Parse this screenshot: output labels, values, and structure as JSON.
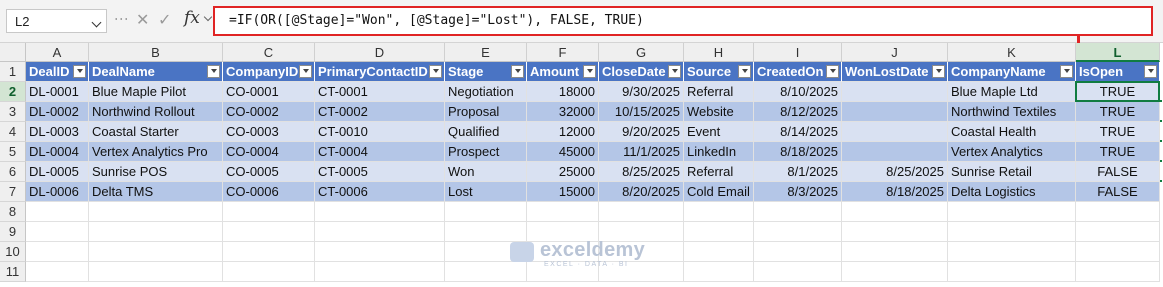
{
  "namebox": {
    "value": "L2"
  },
  "formula": {
    "text": "=IF(OR([@Stage]=\"Won\", [@Stage]=\"Lost\"), FALSE, TRUE)"
  },
  "toolbar_icons": [
    "cancel-icon",
    "enter-check-icon",
    "insert-function-icon"
  ],
  "columns": [
    "A",
    "B",
    "C",
    "D",
    "E",
    "F",
    "G",
    "H",
    "I",
    "J",
    "K",
    "L"
  ],
  "active_column": "L",
  "rows": [
    "1",
    "2",
    "3",
    "4",
    "5",
    "6",
    "7",
    "8",
    "9",
    "10",
    "11"
  ],
  "active_row": "2",
  "table": {
    "headers": [
      "DealID",
      "DealName",
      "CompanyID",
      "PrimaryContactID",
      "Stage",
      "Amount",
      "CloseDate",
      "Source",
      "CreatedOn",
      "WonLostDate",
      "CompanyName",
      "IsOpen"
    ],
    "rows": [
      [
        "DL-0001",
        "Blue Maple Pilot",
        "CO-0001",
        "CT-0001",
        "Negotiation",
        "18000",
        "9/30/2025",
        "Referral",
        "8/10/2025",
        "",
        "Blue Maple Ltd",
        "TRUE"
      ],
      [
        "DL-0002",
        "Northwind Rollout",
        "CO-0002",
        "CT-0002",
        "Proposal",
        "32000",
        "10/15/2025",
        "Website",
        "8/12/2025",
        "",
        "Northwind Textiles",
        "TRUE"
      ],
      [
        "DL-0003",
        "Coastal Starter",
        "CO-0003",
        "CT-0010",
        "Qualified",
        "12000",
        "9/20/2025",
        "Event",
        "8/14/2025",
        "",
        "Coastal Health",
        "TRUE"
      ],
      [
        "DL-0004",
        "Vertex Analytics Pro",
        "CO-0004",
        "CT-0004",
        "Prospect",
        "45000",
        "11/1/2025",
        "LinkedIn",
        "8/18/2025",
        "",
        "Vertex Analytics",
        "TRUE"
      ],
      [
        "DL-0005",
        "Sunrise POS",
        "CO-0005",
        "CT-0005",
        "Won",
        "25000",
        "8/25/2025",
        "Referral",
        "8/1/2025",
        "8/25/2025",
        "Sunrise Retail",
        "FALSE"
      ],
      [
        "DL-0006",
        "Delta TMS",
        "CO-0006",
        "CT-0006",
        "Lost",
        "15000",
        "8/20/2025",
        "Cold Email",
        "8/3/2025",
        "8/18/2025",
        "Delta Logistics",
        "FALSE"
      ]
    ]
  },
  "watermark": {
    "title": "exceldemy",
    "subtitle": "EXCEL · DATA · BI"
  },
  "colors": {
    "header_fill": "#4a74c4",
    "band_light": "#d9e1f2",
    "band_dark": "#b4c6e7",
    "selection": "#107c41",
    "highlight": "#e02424"
  }
}
